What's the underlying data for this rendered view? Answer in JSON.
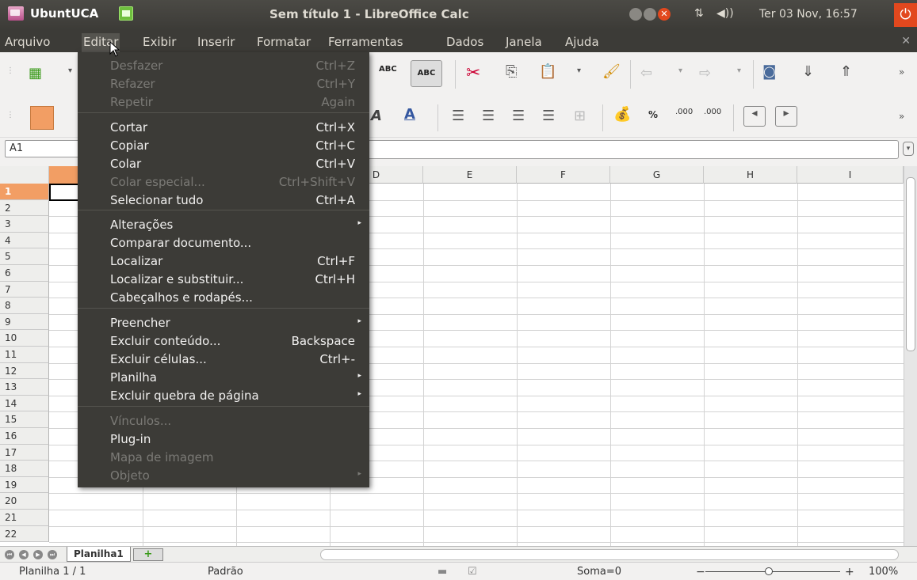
{
  "top_panel": {
    "app_name": "UbuntUCA",
    "window_title": "Sem título 1 - LibreOffice Calc",
    "clock": "Ter 03 Nov, 16:57"
  },
  "menubar": {
    "items": [
      "Arquivo",
      "Editar",
      "Exibir",
      "Inserir",
      "Formatar",
      "Ferramentas",
      "Dados",
      "Janela",
      "Ajuda"
    ],
    "active": "Editar"
  },
  "formula_bar": {
    "name_box": "A1"
  },
  "columns": [
    "D",
    "E",
    "F",
    "G",
    "H",
    "I"
  ],
  "rows": [
    "1",
    "2",
    "3",
    "4",
    "5",
    "6",
    "7",
    "8",
    "9",
    "10",
    "11",
    "12",
    "13",
    "14",
    "15",
    "16",
    "17",
    "18",
    "19",
    "20",
    "21",
    "22"
  ],
  "sheet_tabs": {
    "active": "Planilha1"
  },
  "status_bar": {
    "sheet": "Planilha 1 / 1",
    "style": "Padrão",
    "sum": "Soma=0",
    "zoom": "100%",
    "zoom_level": 1.0
  },
  "edit_menu": {
    "items": [
      {
        "label": "Desfazer",
        "shortcut": "Ctrl+Z",
        "disabled": true
      },
      {
        "label": "Refazer",
        "shortcut": "Ctrl+Y",
        "disabled": true
      },
      {
        "label": "Repetir",
        "shortcut": "Again",
        "disabled": true
      },
      {
        "label": "Cortar",
        "shortcut": "Ctrl+X",
        "disabled": false
      },
      {
        "label": "Copiar",
        "shortcut": "Ctrl+C",
        "disabled": false
      },
      {
        "label": "Colar",
        "shortcut": "Ctrl+V",
        "disabled": false
      },
      {
        "label": "Colar especial...",
        "shortcut": "Ctrl+Shift+V",
        "disabled": true
      },
      {
        "label": "Selecionar tudo",
        "shortcut": "Ctrl+A",
        "disabled": false
      },
      {
        "label": "Alterações",
        "shortcut": "",
        "disabled": false,
        "submenu": true
      },
      {
        "label": "Comparar documento...",
        "shortcut": "",
        "disabled": false
      },
      {
        "label": "Localizar",
        "shortcut": "Ctrl+F",
        "disabled": false
      },
      {
        "label": "Localizar e substituir...",
        "shortcut": "Ctrl+H",
        "disabled": false
      },
      {
        "label": "Cabeçalhos e rodapés...",
        "shortcut": "",
        "disabled": false
      },
      {
        "label": "Preencher",
        "shortcut": "",
        "disabled": false,
        "submenu": true
      },
      {
        "label": "Excluir conteúdo...",
        "shortcut": "Backspace",
        "disabled": false
      },
      {
        "label": "Excluir células...",
        "shortcut": "Ctrl+-",
        "disabled": false
      },
      {
        "label": "Planilha",
        "shortcut": "",
        "disabled": false,
        "submenu": true
      },
      {
        "label": "Excluir quebra de página",
        "shortcut": "",
        "disabled": false,
        "submenu": true
      },
      {
        "label": "Vínculos...",
        "shortcut": "",
        "disabled": true
      },
      {
        "label": "Plug-in",
        "shortcut": "",
        "disabled": false
      },
      {
        "label": "Mapa de imagem",
        "shortcut": "",
        "disabled": true
      },
      {
        "label": "Objeto",
        "shortcut": "",
        "disabled": true,
        "submenu": true
      }
    ]
  },
  "colors": {
    "panel_bg": "#3c3b37",
    "selection_orange": "#f29e64",
    "close_orange": "#e2481e"
  }
}
